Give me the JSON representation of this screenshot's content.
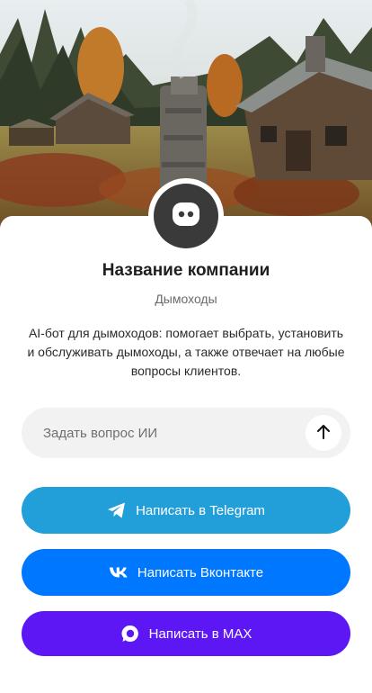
{
  "company": {
    "name": "Название компании",
    "category": "Дымоходы",
    "description": "AI-бот для дымоходов: помогает выбрать, установить и обслуживать дымоходы, а также отвечает на любые вопросы клиентов."
  },
  "ask": {
    "placeholder": "Задать вопрос ИИ",
    "send_icon": "arrow-up-icon"
  },
  "buttons": [
    {
      "label": "Написать в Telegram",
      "icon": "telegram-icon",
      "color": "#229ed9"
    },
    {
      "label": "Написать Вконтакте",
      "icon": "vk-icon",
      "color": "#0077ff"
    },
    {
      "label": "Написать в MAX",
      "icon": "max-icon",
      "color": "#5d17f5"
    }
  ],
  "colors": {
    "avatar_bg": "#3a3a3a",
    "input_bg": "#f2f2f2"
  },
  "hero": {
    "icon": "cover-photo"
  }
}
